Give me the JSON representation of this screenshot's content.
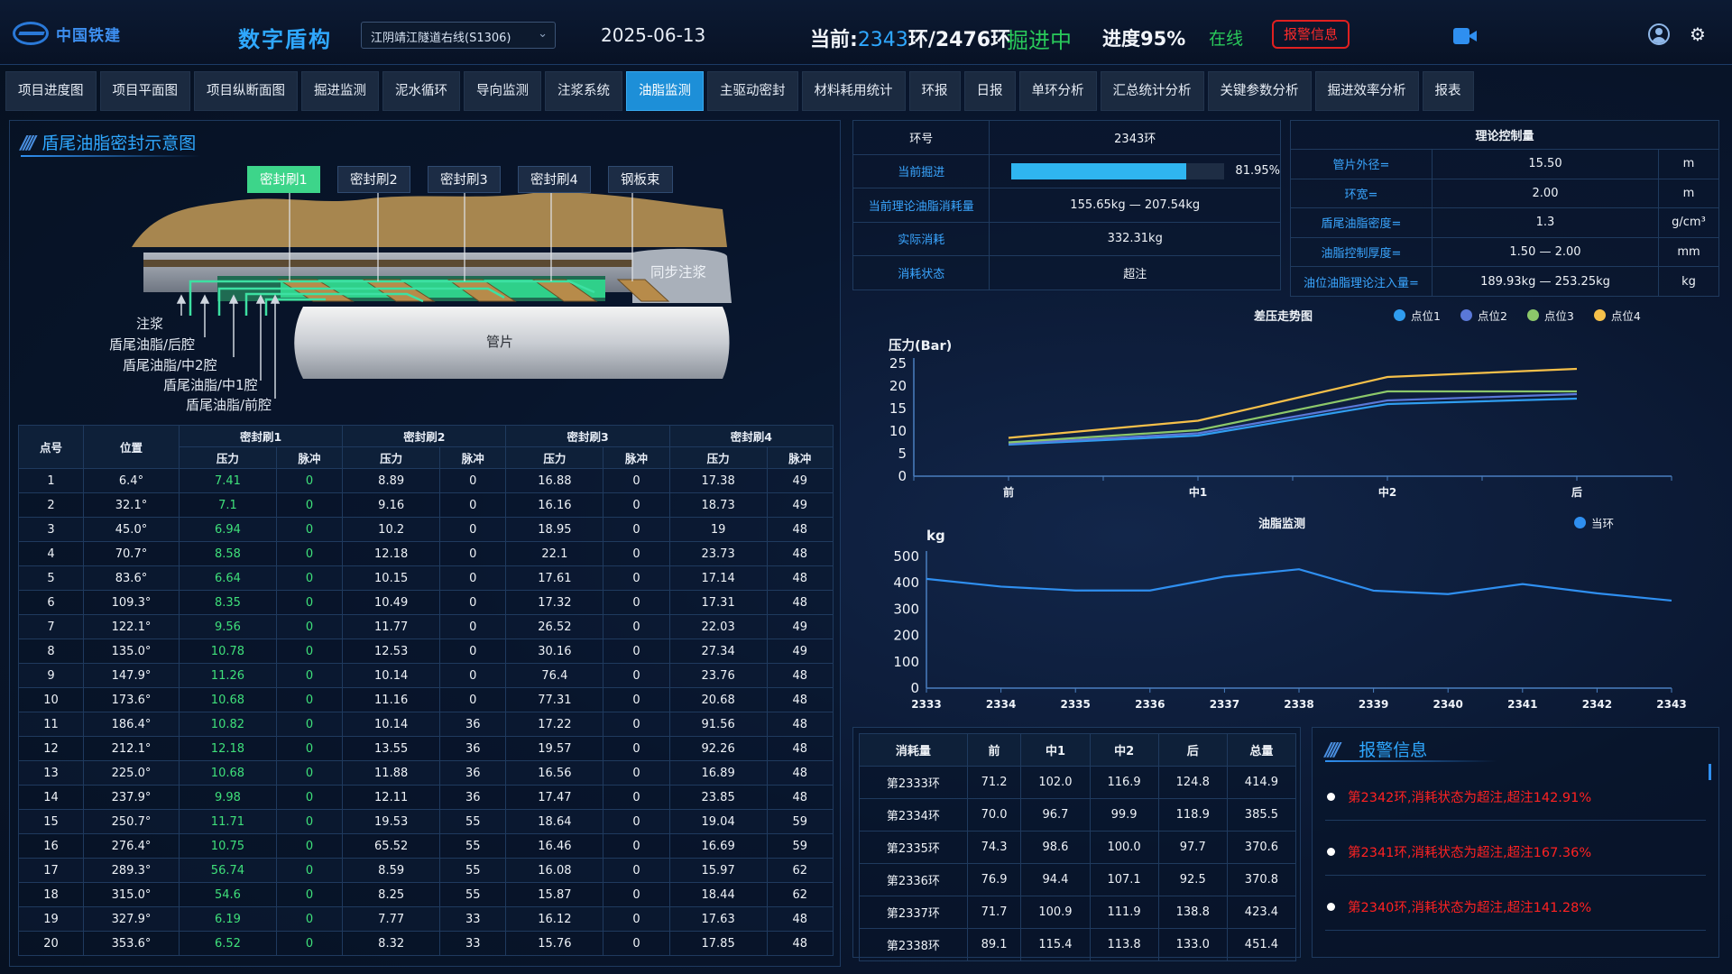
{
  "header": {
    "logo_text": "中国铁建",
    "app_title": "数字盾构",
    "project": "江阴靖江隧道右线(S1306)",
    "date": "2025-06-13",
    "ring_prefix": "当前:",
    "ring_current": "2343",
    "ring_suffix": "环/2476环",
    "state": "掘进中",
    "progress": "进度95%",
    "online": "在线",
    "alarm_button": "报警信息"
  },
  "nav": {
    "tabs": [
      "项目进度图",
      "项目平面图",
      "项目纵断面图",
      "掘进监测",
      "泥水循环",
      "导向监测",
      "注浆系统",
      "油脂监测",
      "主驱动密封",
      "材料耗用统计",
      "环报",
      "日报",
      "单环分析",
      "汇总统计分析",
      "关键参数分析",
      "掘进效率分析",
      "报表"
    ],
    "active_index": 7
  },
  "diagram": {
    "title": "盾尾油脂密封示意图",
    "brushes": [
      "密封刷1",
      "密封刷2",
      "密封刷3",
      "密封刷4",
      "钢板束"
    ],
    "labels": {
      "grout": "注浆",
      "rear": "盾尾油脂/后腔",
      "mid2": "盾尾油脂/中2腔",
      "mid1": "盾尾油脂/中1腔",
      "front": "盾尾油脂/前腔",
      "sync": "同步注浆",
      "segment": "管片"
    },
    "colors": {
      "soil": "#a7864f",
      "active_brush": "#3dd58a",
      "shell": "#8f98a6"
    }
  },
  "seal_table": {
    "header_point": "点号",
    "header_pos": "位置",
    "groups": [
      "密封刷1",
      "密封刷2",
      "密封刷3",
      "密封刷4"
    ],
    "sub_pressure": "压力",
    "sub_pulse": "脉冲",
    "rows": [
      [
        "1",
        "6.4°",
        "7.41",
        "0",
        "8.89",
        "0",
        "16.88",
        "0",
        "17.38",
        "49"
      ],
      [
        "2",
        "32.1°",
        "7.1",
        "0",
        "9.16",
        "0",
        "16.16",
        "0",
        "18.73",
        "49"
      ],
      [
        "3",
        "45.0°",
        "6.94",
        "0",
        "10.2",
        "0",
        "18.95",
        "0",
        "19",
        "48"
      ],
      [
        "4",
        "70.7°",
        "8.58",
        "0",
        "12.18",
        "0",
        "22.1",
        "0",
        "23.73",
        "48"
      ],
      [
        "5",
        "83.6°",
        "6.64",
        "0",
        "10.15",
        "0",
        "17.61",
        "0",
        "17.14",
        "48"
      ],
      [
        "6",
        "109.3°",
        "8.35",
        "0",
        "10.49",
        "0",
        "17.32",
        "0",
        "17.31",
        "48"
      ],
      [
        "7",
        "122.1°",
        "9.56",
        "0",
        "11.77",
        "0",
        "26.52",
        "0",
        "22.03",
        "49"
      ],
      [
        "8",
        "135.0°",
        "10.78",
        "0",
        "12.53",
        "0",
        "30.16",
        "0",
        "27.34",
        "49"
      ],
      [
        "9",
        "147.9°",
        "11.26",
        "0",
        "10.14",
        "0",
        "76.4",
        "0",
        "23.76",
        "48"
      ],
      [
        "10",
        "173.6°",
        "10.68",
        "0",
        "11.16",
        "0",
        "77.31",
        "0",
        "20.68",
        "48"
      ],
      [
        "11",
        "186.4°",
        "10.82",
        "0",
        "10.14",
        "36",
        "17.22",
        "0",
        "91.56",
        "48"
      ],
      [
        "12",
        "212.1°",
        "12.18",
        "0",
        "13.55",
        "36",
        "19.57",
        "0",
        "92.26",
        "48"
      ],
      [
        "13",
        "225.0°",
        "10.68",
        "0",
        "11.88",
        "36",
        "16.56",
        "0",
        "16.89",
        "48"
      ],
      [
        "14",
        "237.9°",
        "9.98",
        "0",
        "12.11",
        "36",
        "17.47",
        "0",
        "23.85",
        "48"
      ],
      [
        "15",
        "250.7°",
        "11.71",
        "0",
        "19.53",
        "55",
        "18.64",
        "0",
        "19.04",
        "59"
      ],
      [
        "16",
        "276.4°",
        "10.75",
        "0",
        "65.52",
        "55",
        "16.46",
        "0",
        "16.69",
        "59"
      ],
      [
        "17",
        "289.3°",
        "56.74",
        "0",
        "8.59",
        "55",
        "16.08",
        "0",
        "15.97",
        "62"
      ],
      [
        "18",
        "315.0°",
        "54.6",
        "0",
        "8.25",
        "55",
        "15.87",
        "0",
        "18.44",
        "62"
      ],
      [
        "19",
        "327.9°",
        "6.19",
        "0",
        "7.77",
        "33",
        "16.12",
        "0",
        "17.63",
        "48"
      ],
      [
        "20",
        "353.6°",
        "6.52",
        "0",
        "8.32",
        "33",
        "15.76",
        "0",
        "17.85",
        "48"
      ]
    ]
  },
  "info": {
    "ring_label": "环号",
    "ring_value": "2343环",
    "progress_label": "当前掘进",
    "progress_value": "81.95%",
    "progress_fraction": 0.8195,
    "theory_label": "当前理论油脂消耗量",
    "theory_value": "155.65kg — 207.54kg",
    "actual_label": "实际消耗",
    "actual_value": "332.31kg",
    "status_label": "消耗状态",
    "status_value": "超注"
  },
  "theory": {
    "title": "理论控制量",
    "rows": [
      [
        "管片外径=",
        "15.50",
        "m"
      ],
      [
        "环宽=",
        "2.00",
        "m"
      ],
      [
        "盾尾油脂密度=",
        "1.3",
        "g/cm³"
      ],
      [
        "油脂控制厚度=",
        "1.50 — 2.00",
        "mm"
      ],
      [
        "油位油脂理论注入量=",
        "189.93kg — 253.25kg",
        "kg"
      ]
    ]
  },
  "chart_data": [
    {
      "type": "line",
      "title": "差压走势图",
      "ylabel": "压力(Bar)",
      "categories": [
        "前",
        "中1",
        "中2",
        "后"
      ],
      "ylim": [
        0,
        25
      ],
      "yticks": [
        0,
        5,
        10,
        15,
        20,
        25
      ],
      "legend_position": "top-right",
      "series": [
        {
          "name": "点位1",
          "color": "#2f9df0",
          "values": [
            7.0,
            9.0,
            16.0,
            17.2
          ]
        },
        {
          "name": "点位2",
          "color": "#5a78d8",
          "values": [
            7.2,
            9.5,
            16.8,
            18.2
          ]
        },
        {
          "name": "点位3",
          "color": "#8cc76a",
          "values": [
            7.5,
            10.2,
            18.8,
            18.8
          ]
        },
        {
          "name": "点位4",
          "color": "#f5c04a",
          "values": [
            8.5,
            12.3,
            22.0,
            23.8
          ]
        }
      ]
    },
    {
      "type": "line",
      "title": "油脂监测",
      "ylabel": "kg",
      "categories": [
        "2333",
        "2334",
        "2335",
        "2336",
        "2337",
        "2338",
        "2339",
        "2340",
        "2341",
        "2342",
        "2343"
      ],
      "ylim": [
        0,
        500
      ],
      "yticks": [
        0,
        100,
        200,
        300,
        400,
        500
      ],
      "legend_position": "top-right",
      "series": [
        {
          "name": "当环",
          "color": "#2f8ff0",
          "values": [
            414.9,
            385.5,
            370.6,
            370.8,
            423.4,
            451.4,
            370,
            357,
            395,
            360,
            332.31
          ]
        }
      ]
    }
  ],
  "consumption": {
    "headers": [
      "消耗量",
      "前",
      "中1",
      "中2",
      "后",
      "总量"
    ],
    "rows": [
      [
        "第2333环",
        "71.2",
        "102.0",
        "116.9",
        "124.8",
        "414.9"
      ],
      [
        "第2334环",
        "70.0",
        "96.7",
        "99.9",
        "118.9",
        "385.5"
      ],
      [
        "第2335环",
        "74.3",
        "98.6",
        "100.0",
        "97.7",
        "370.6"
      ],
      [
        "第2336环",
        "76.9",
        "94.4",
        "107.1",
        "92.5",
        "370.8"
      ],
      [
        "第2337环",
        "71.7",
        "100.9",
        "111.9",
        "138.8",
        "423.4"
      ],
      [
        "第2338环",
        "89.1",
        "115.4",
        "113.8",
        "133.0",
        "451.4"
      ]
    ]
  },
  "alarms": {
    "title": "报警信息",
    "items": [
      "第2342环,消耗状态为超注,超注142.91%",
      "第2341环,消耗状态为超注,超注167.36%",
      "第2340环,消耗状态为超注,超注141.28%"
    ]
  }
}
